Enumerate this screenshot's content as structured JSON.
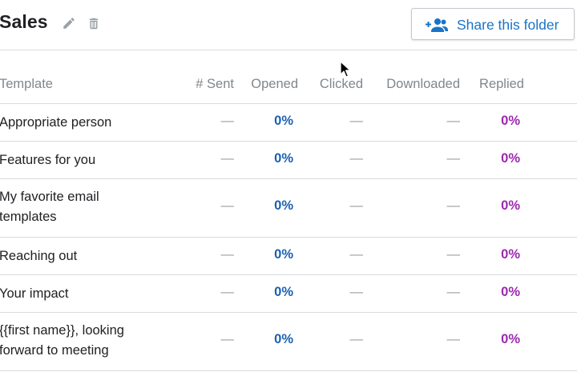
{
  "header": {
    "folder_title": "Sales",
    "share_button_label": "Share this folder",
    "icons": {
      "edit": "pencil-icon",
      "delete": "trash-icon",
      "share": "people-add-icon"
    }
  },
  "table": {
    "columns": {
      "template": "Template",
      "sent": "# Sent",
      "opened": "Opened",
      "clicked": "Clicked",
      "downloaded": "Downloaded",
      "replied": "Replied"
    },
    "rows": [
      {
        "template": "Appropriate person",
        "sent": "—",
        "opened": "0%",
        "clicked": "—",
        "downloaded": "—",
        "replied": "0%"
      },
      {
        "template": "Features for you",
        "sent": "—",
        "opened": "0%",
        "clicked": "—",
        "downloaded": "—",
        "replied": "0%"
      },
      {
        "template": "My favorite email templates",
        "sent": "—",
        "opened": "0%",
        "clicked": "—",
        "downloaded": "—",
        "replied": "0%"
      },
      {
        "template": "Reaching out",
        "sent": "—",
        "opened": "0%",
        "clicked": "—",
        "downloaded": "—",
        "replied": "0%"
      },
      {
        "template": "Your impact",
        "sent": "—",
        "opened": "0%",
        "clicked": "—",
        "downloaded": "—",
        "replied": "0%"
      },
      {
        "template": "{{first name}}, looking forward to meeting",
        "sent": "—",
        "opened": "0%",
        "clicked": "—",
        "downloaded": "—",
        "replied": "0%"
      }
    ]
  },
  "colors": {
    "accent_blue": "#1a73c8",
    "opened_blue": "#1a5fb4",
    "replied_purple": "#9c27b0",
    "muted_gray": "#80868b",
    "divider": "#dadce0"
  }
}
